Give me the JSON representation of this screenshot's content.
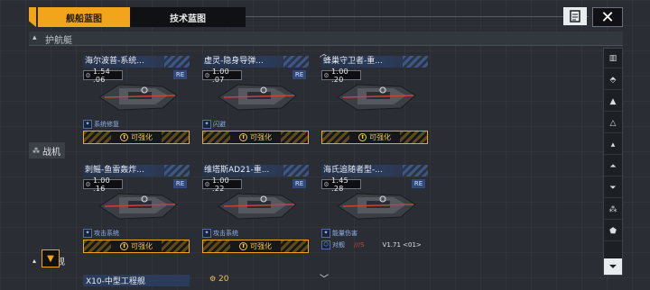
{
  "tabs": {
    "active": "舰船蓝图",
    "inactive": "技术蓝图"
  },
  "section": {
    "title": "护航艇"
  },
  "side_labels": {
    "fighter": "战机",
    "frigate": "舰"
  },
  "cards": [
    {
      "name": "海尔波普-系统...",
      "power": "1.54 .06",
      "badge": "RE",
      "tag": "系统修复",
      "action": "可强化"
    },
    {
      "name": "虚灵-隐身导弹...",
      "power": "1.00 .07",
      "badge": "RE",
      "tag": "闪避",
      "action": "可强化"
    },
    {
      "name": "蜂巢守卫者-重...",
      "power": "1.00 .20",
      "badge": "",
      "tag": "",
      "action": "可强化"
    },
    {
      "name": "刺鳐-鱼雷轰炸...",
      "power": "1.00 .16",
      "badge": "RE",
      "tag": "攻击系统",
      "action": "可强化"
    },
    {
      "name": "维塔斯AD21-重...",
      "power": "1.00 .22",
      "badge": "RE",
      "tag": "攻击系统",
      "action": "可强化"
    },
    {
      "name": "海氏追随者型-...",
      "power": "1.45 .28",
      "badge": "RE",
      "tag": "能量伤害",
      "tag2": "对舰",
      "extra": "V1.71 <01>",
      "extra2": "///S"
    }
  ],
  "bottom": {
    "next_name": "X10-中型工程舰",
    "cost": "20"
  },
  "colors": {
    "accent": "#f2a51a",
    "card_bar": "#2b3b5a",
    "background": "#2a2d33"
  }
}
